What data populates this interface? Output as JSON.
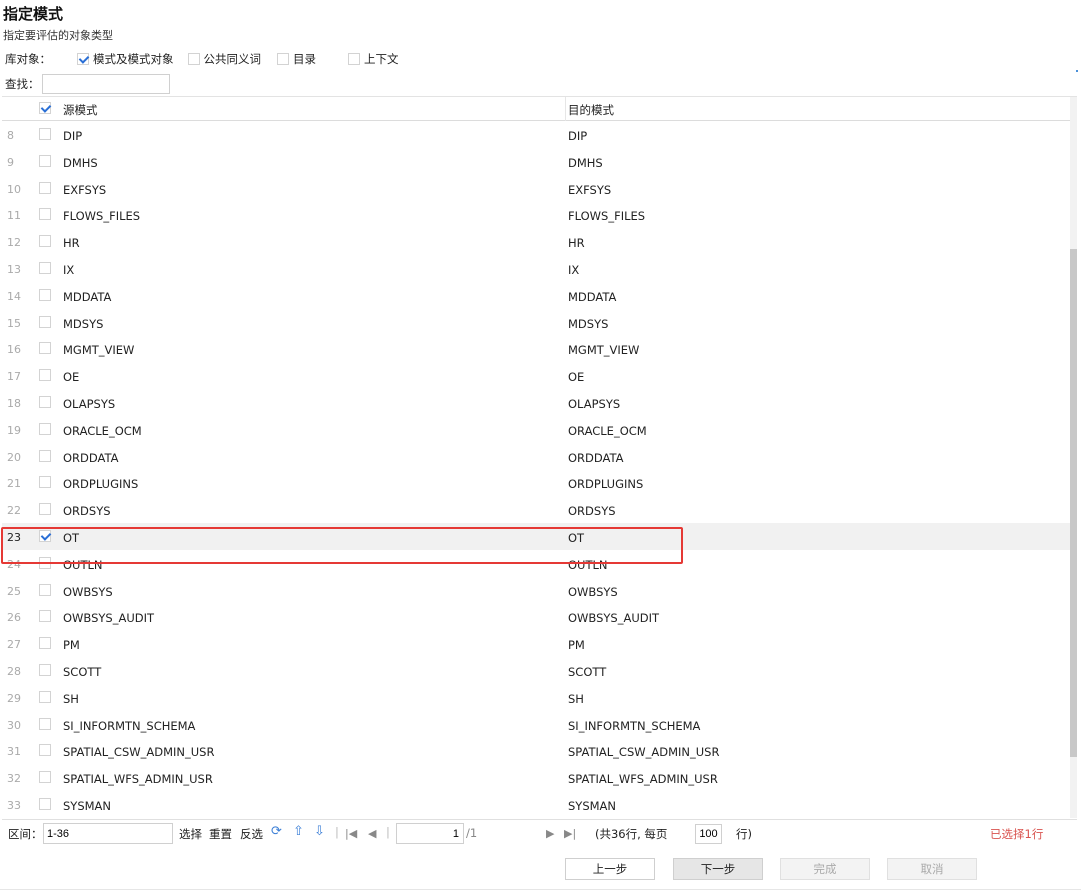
{
  "header": {
    "title": "指定模式",
    "subtitle": "指定要评估的对象类型"
  },
  "filters": {
    "label": "库对象：",
    "options": [
      {
        "label": "模式及模式对象",
        "checked": true
      },
      {
        "label": "公共同义词",
        "checked": false
      },
      {
        "label": "目录",
        "checked": false
      },
      {
        "label": "上下文",
        "checked": false
      }
    ]
  },
  "search": {
    "label": "查找：",
    "value": ""
  },
  "grid": {
    "columns": {
      "source": "源模式",
      "target": "目的模式"
    },
    "header_checked": true,
    "rows": [
      {
        "num": "8",
        "source": "DIP",
        "target": "DIP",
        "checked": false
      },
      {
        "num": "9",
        "source": "DMHS",
        "target": "DMHS",
        "checked": false
      },
      {
        "num": "10",
        "source": "EXFSYS",
        "target": "EXFSYS",
        "checked": false
      },
      {
        "num": "11",
        "source": "FLOWS_FILES",
        "target": "FLOWS_FILES",
        "checked": false
      },
      {
        "num": "12",
        "source": "HR",
        "target": "HR",
        "checked": false
      },
      {
        "num": "13",
        "source": "IX",
        "target": "IX",
        "checked": false
      },
      {
        "num": "14",
        "source": "MDDATA",
        "target": "MDDATA",
        "checked": false
      },
      {
        "num": "15",
        "source": "MDSYS",
        "target": "MDSYS",
        "checked": false
      },
      {
        "num": "16",
        "source": "MGMT_VIEW",
        "target": "MGMT_VIEW",
        "checked": false
      },
      {
        "num": "17",
        "source": "OE",
        "target": "OE",
        "checked": false
      },
      {
        "num": "18",
        "source": "OLAPSYS",
        "target": "OLAPSYS",
        "checked": false
      },
      {
        "num": "19",
        "source": "ORACLE_OCM",
        "target": "ORACLE_OCM",
        "checked": false
      },
      {
        "num": "20",
        "source": "ORDDATA",
        "target": "ORDDATA",
        "checked": false
      },
      {
        "num": "21",
        "source": "ORDPLUGINS",
        "target": "ORDPLUGINS",
        "checked": false
      },
      {
        "num": "22",
        "source": "ORDSYS",
        "target": "ORDSYS",
        "checked": false
      },
      {
        "num": "23",
        "source": "OT",
        "target": "OT",
        "checked": true
      },
      {
        "num": "24",
        "source": "OUTLN",
        "target": "OUTLN",
        "checked": false
      },
      {
        "num": "25",
        "source": "OWBSYS",
        "target": "OWBSYS",
        "checked": false
      },
      {
        "num": "26",
        "source": "OWBSYS_AUDIT",
        "target": "OWBSYS_AUDIT",
        "checked": false
      },
      {
        "num": "27",
        "source": "PM",
        "target": "PM",
        "checked": false
      },
      {
        "num": "28",
        "source": "SCOTT",
        "target": "SCOTT",
        "checked": false
      },
      {
        "num": "29",
        "source": "SH",
        "target": "SH",
        "checked": false
      },
      {
        "num": "30",
        "source": "SI_INFORMTN_SCHEMA",
        "target": "SI_INFORMTN_SCHEMA",
        "checked": false
      },
      {
        "num": "31",
        "source": "SPATIAL_CSW_ADMIN_USR",
        "target": "SPATIAL_CSW_ADMIN_USR",
        "checked": false
      },
      {
        "num": "32",
        "source": "SPATIAL_WFS_ADMIN_USR",
        "target": "SPATIAL_WFS_ADMIN_USR",
        "checked": false
      },
      {
        "num": "33",
        "source": "SYSMAN",
        "target": "SYSMAN",
        "checked": false
      }
    ]
  },
  "pager": {
    "range_label": "区间：",
    "range_value": "1-36",
    "select_label": "选择",
    "reset_label": "重置",
    "invert_label": "反选",
    "page_value": "1",
    "total_pages": "/1",
    "record_info": "(共36行, 每页",
    "page_size": "100",
    "row_unit": "行)",
    "selected_count": "已选择1行"
  },
  "footer": {
    "prev_label": "上一步",
    "next_label": "下一步",
    "finish_label": "完成",
    "cancel_label": "取消"
  },
  "colors": {
    "accent": "#2a6fd6",
    "highlight": "#e53935",
    "selected_text": "#d9534f"
  }
}
